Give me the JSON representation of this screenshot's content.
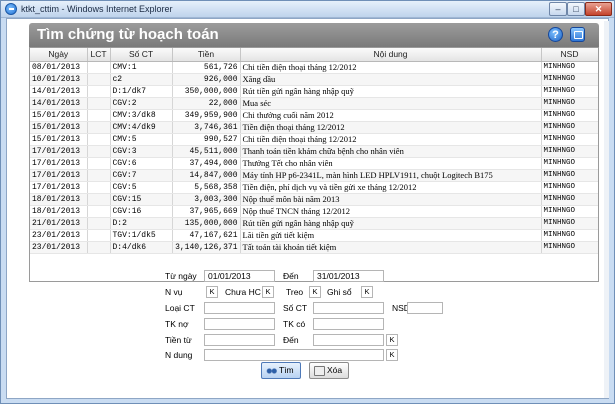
{
  "window": {
    "title": "ktkt_cttim - Windows Internet Explorer",
    "minimize": "–",
    "maximize": "□",
    "close": "✕"
  },
  "header": {
    "title": "Tìm chứng từ hoạch toán",
    "help": "?"
  },
  "grid": {
    "columns": [
      "Ngày",
      "LCT",
      "Số CT",
      "Tiền",
      "Nội dung",
      "NSD"
    ],
    "rows": [
      [
        "08/01/2013",
        "",
        "CMV:1",
        "561,726",
        "Chi tiền điện thoại tháng 12/2012",
        "MINHNGO"
      ],
      [
        "10/01/2013",
        "",
        "c2",
        "926,000",
        "Xăng dầu",
        "MINHNGO"
      ],
      [
        "14/01/2013",
        "",
        "D:1/dk7",
        "350,000,000",
        "Rút tiền gửi ngân hàng nhập quỹ",
        "MINHNGO"
      ],
      [
        "14/01/2013",
        "",
        "CGV:2",
        "22,000",
        "Mua séc",
        "MINHNGO"
      ],
      [
        "15/01/2013",
        "",
        "CMV:3/dk8",
        "349,959,900",
        "Chi thưởng cuối năm 2012",
        "MINHNGO"
      ],
      [
        "15/01/2013",
        "",
        "CMV:4/dk9",
        "3,746,361",
        "Tiền điện thoại tháng 12/2012",
        "MINHNGO"
      ],
      [
        "15/01/2013",
        "",
        "CMV:5",
        "990,527",
        "Chi tiền điện thoại tháng 12/2012",
        "MINHNGO"
      ],
      [
        "17/01/2013",
        "",
        "CGV:3",
        "45,511,000",
        "Thanh toán tiền khám chữa bệnh cho nhân viên",
        "MINHNGO"
      ],
      [
        "17/01/2013",
        "",
        "CGV:6",
        "37,494,000",
        "Thưởng Tết cho nhân viên",
        "MINHNGO"
      ],
      [
        "17/01/2013",
        "",
        "CGV:7",
        "14,847,000",
        "Máy tính HP p6-2341L, màn hình LED HPLV1911, chuột Logitech B175",
        "MINHNGO"
      ],
      [
        "17/01/2013",
        "",
        "CGV:5",
        "5,568,358",
        "Tiền điện, phí dịch vụ và tiền gửi xe tháng 12/2012",
        "MINHNGO"
      ],
      [
        "18/01/2013",
        "",
        "CGV:15",
        "3,003,300",
        "Nộp thuế môn bài năm 2013",
        "MINHNGO"
      ],
      [
        "18/01/2013",
        "",
        "CGV:16",
        "37,965,669",
        "Nộp thuế TNCN tháng 12/2012",
        "MINHNGO"
      ],
      [
        "21/01/2013",
        "",
        "D:2",
        "135,000,000",
        "Rút tiền gửi ngân hàng nhập quỹ",
        "MINHNGO"
      ],
      [
        "23/01/2013",
        "",
        "TGV:1/dk5",
        "47,167,621",
        "Lãi tiền gửi tiết kiệm",
        "MINHNGO"
      ],
      [
        "23/01/2013",
        "",
        "D:4/dk6",
        "3,140,126,371",
        "Tất toán tài khoản tiết kiệm",
        "MINHNGO"
      ]
    ]
  },
  "filters": {
    "from_date_label": "Từ ngày",
    "from_date": "01/01/2013",
    "to_date_label": "Đến",
    "to_date": "31/01/2013",
    "nvu_label": "N vụ",
    "nvu_k1": "K",
    "nvu_value": "Chưa HC",
    "nvu_k2": "K",
    "treo_label": "Treo",
    "treo_k1": "K",
    "ghiso_value": "Ghi sổ",
    "treo_k2": "K",
    "loaict_label": "Loại CT",
    "soct_label": "Số CT",
    "nsd_label": "NSD",
    "tkno_label": "TK nợ",
    "tkco_label": "TK có",
    "tientu_label": "Tiền từ",
    "den2_label": "Đến",
    "tien_k": "K",
    "ndung_label": "N dung",
    "ndung_k": "K"
  },
  "buttons": {
    "search": "Tìm",
    "clear": "Xóa"
  }
}
